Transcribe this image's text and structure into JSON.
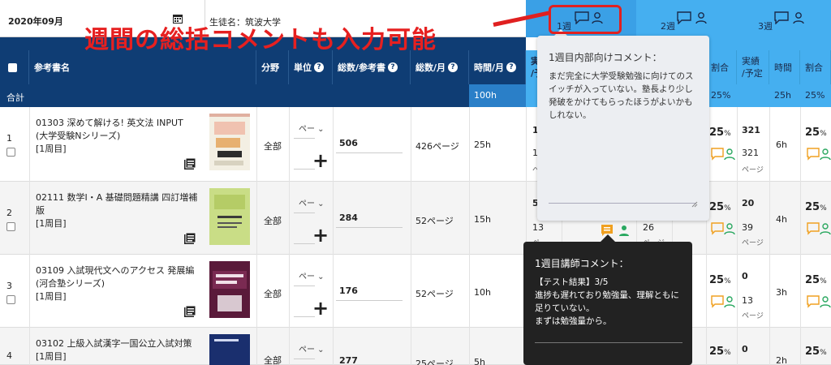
{
  "header": {
    "month": "2020年09月",
    "student": "生徒名：筑波大学",
    "annotation": "週間の総括コメントも入力可能",
    "weeks": [
      {
        "label": "1週"
      },
      {
        "label": "2週"
      },
      {
        "label": "3週"
      }
    ]
  },
  "table": {
    "columns": {
      "book": "参考書名",
      "field": "分野",
      "unit": "単位",
      "total_per_book": "総数/参考書",
      "total_per_month": "総数/月",
      "hours_per_month": "時間/月",
      "week1_actual_short": "実",
      "week1_plan_short": "/予",
      "ratio": "割合",
      "actual_plan": "実績\n/予定",
      "time": "時間"
    },
    "total_row": {
      "label": "合計",
      "hours": "100h",
      "w2_pct": "25%",
      "w3_hours": "25h",
      "w3_pct": "25%"
    },
    "rows": [
      {
        "num": "1",
        "title": "01303 深めて解ける! 英文法 INPUT (大学受験Nシリーズ)",
        "round": "[1周目]",
        "field": "全部",
        "unit": "ペー",
        "total": "506",
        "per_month": "426ページ",
        "hours": "25h",
        "w1_actual": "10",
        "w1_plan": "10",
        "w1_pages": "ペー",
        "w2_pct": "25",
        "w3_actual": "321",
        "w3_plan": "321",
        "w3_pages": "ページ",
        "w3_hours": "6h",
        "w3_pct": "25"
      },
      {
        "num": "2",
        "title": "02111 数学I・A 基礎問題精講 四訂増補版",
        "round": "[1周目]",
        "field": "全部",
        "unit": "ペー",
        "total": "284",
        "per_month": "52ページ",
        "hours": "15h",
        "w1_actual": "5",
        "w1_plan": "13",
        "w1_pages": "ペー",
        "w1b_plan": "26",
        "w1b_pages": "ページ",
        "w2_pct": "25",
        "w3_actual": "20",
        "w3_plan": "39",
        "w3_pages": "ページ",
        "w3_hours": "4h",
        "w3_pct": "25"
      },
      {
        "num": "3",
        "title": "03109 入試現代文へのアクセス 発展編 (河合塾シリーズ)",
        "round": "[1周目]",
        "field": "全部",
        "unit": "ペー",
        "total": "176",
        "per_month": "52ページ",
        "hours": "10h",
        "w2_pct": "25",
        "w3_actual": "0",
        "w3_plan": "13",
        "w3_pages": "ページ",
        "w3_hours": "3h",
        "w3_pct": "25"
      },
      {
        "num": "4",
        "title": "03102 上級入試漢字一国公立入試対策",
        "round": "[1周目]",
        "field": "全部",
        "unit": "ペー",
        "total": "277",
        "per_month": "25ページ",
        "hours": "5h",
        "w2_pct": "25",
        "w3_actual": "0",
        "w3_hours": "2h",
        "w3_pct": "25"
      }
    ]
  },
  "popup_internal": {
    "title": "1週目内部向けコメント：",
    "body": "まだ完全に大学受験勉強に向けてのスイッチが入っていない。塾長より少し発破をかけてもらったほうがよいかもしれない。"
  },
  "popup_teacher": {
    "title": "1週目講師コメント：",
    "line1": "【テスト結果】3/5",
    "line2": "進捗も遅れており勉強量、理解ともに足りていない。",
    "line3": "まずは勉強量から。"
  },
  "colors": {
    "navy": "#0f3d74",
    "week_blue": "#45aff0",
    "annotation_red": "#e62020",
    "comment_icon": "#f0a020",
    "user_icon": "#2aa860"
  },
  "icons": [
    "calendar-icon",
    "comment-icon",
    "user-icon",
    "book-stack-icon",
    "plus-icon",
    "help-icon"
  ]
}
